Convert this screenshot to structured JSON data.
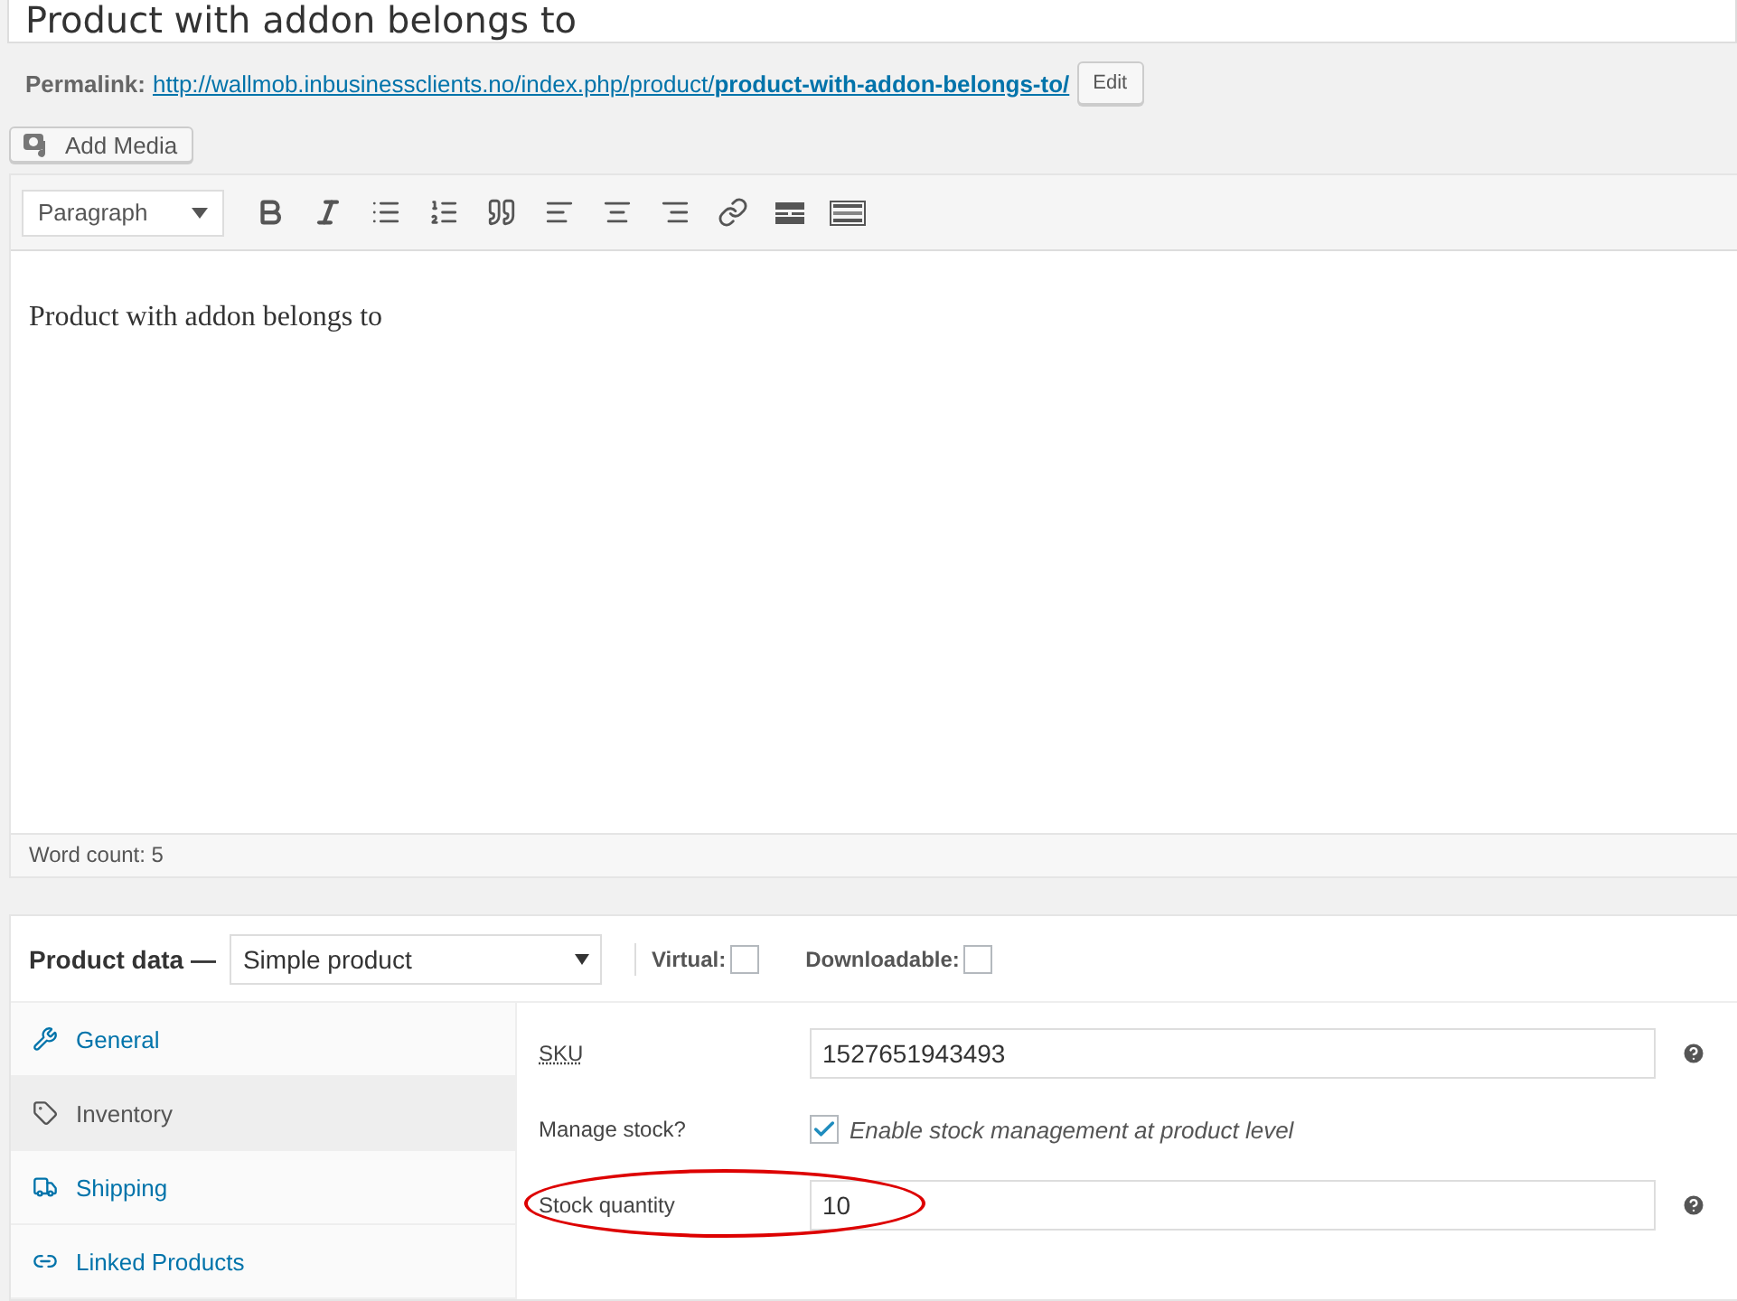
{
  "title": {
    "value": "Product with addon belongs to"
  },
  "permalink": {
    "label": "Permalink:",
    "url_base": "http://wallmob.inbusinessclients.no/index.php/product/",
    "slug": "product-with-addon-belongs-to/",
    "edit_button": "Edit"
  },
  "add_media_button": "Add Media",
  "editor": {
    "format_select": "Paragraph",
    "content": "Product with addon belongs to",
    "word_count": "Word count: 5"
  },
  "product_data": {
    "label": "Product data —",
    "type_select": "Simple product",
    "options": [
      {
        "label": "Virtual:",
        "checked": false
      },
      {
        "label": "Downloadable:",
        "checked": false
      }
    ],
    "tabs": [
      {
        "label": "General",
        "selected": false
      },
      {
        "label": "Inventory",
        "selected": true
      },
      {
        "label": "Shipping",
        "selected": false
      },
      {
        "label": "Linked Products",
        "selected": false
      }
    ],
    "fields": [
      {
        "kind": "text",
        "label": "SKU",
        "value": "1527651943493",
        "highlighted": false
      },
      {
        "kind": "checkbox",
        "label": "Manage stock?",
        "text": "Enable stock management at product level",
        "checked": true
      },
      {
        "kind": "text",
        "label": "Stock quantity",
        "value": "10",
        "highlighted": true
      }
    ]
  }
}
